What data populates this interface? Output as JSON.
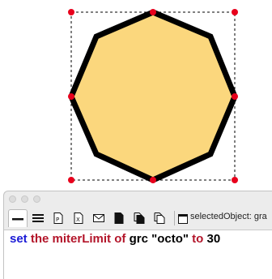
{
  "canvas": {
    "shape_name": "octo",
    "fill_color": "#fbd77d",
    "stroke_color": "#000000",
    "handle_color": "#e8001c"
  },
  "message_box": {
    "selected_object_label": "selectedObject: gra",
    "command_tokens": [
      {
        "text": "set",
        "color": "blue"
      },
      {
        "text": "the",
        "color": "red"
      },
      {
        "text": "miterLimit",
        "color": "red"
      },
      {
        "text": "of",
        "color": "red"
      },
      {
        "text": "grc",
        "color": "black"
      },
      {
        "text": "\"octo\"",
        "color": "black"
      },
      {
        "text": "to",
        "color": "red"
      },
      {
        "text": "30",
        "color": "black"
      }
    ],
    "toolbar_icons": [
      "single-line-icon",
      "multi-line-icon",
      "global-properties-icon",
      "global-variables-icon",
      "pending-messages-icon",
      "front-scripts-icon",
      "back-scripts-icon",
      "libraries-icon"
    ]
  }
}
